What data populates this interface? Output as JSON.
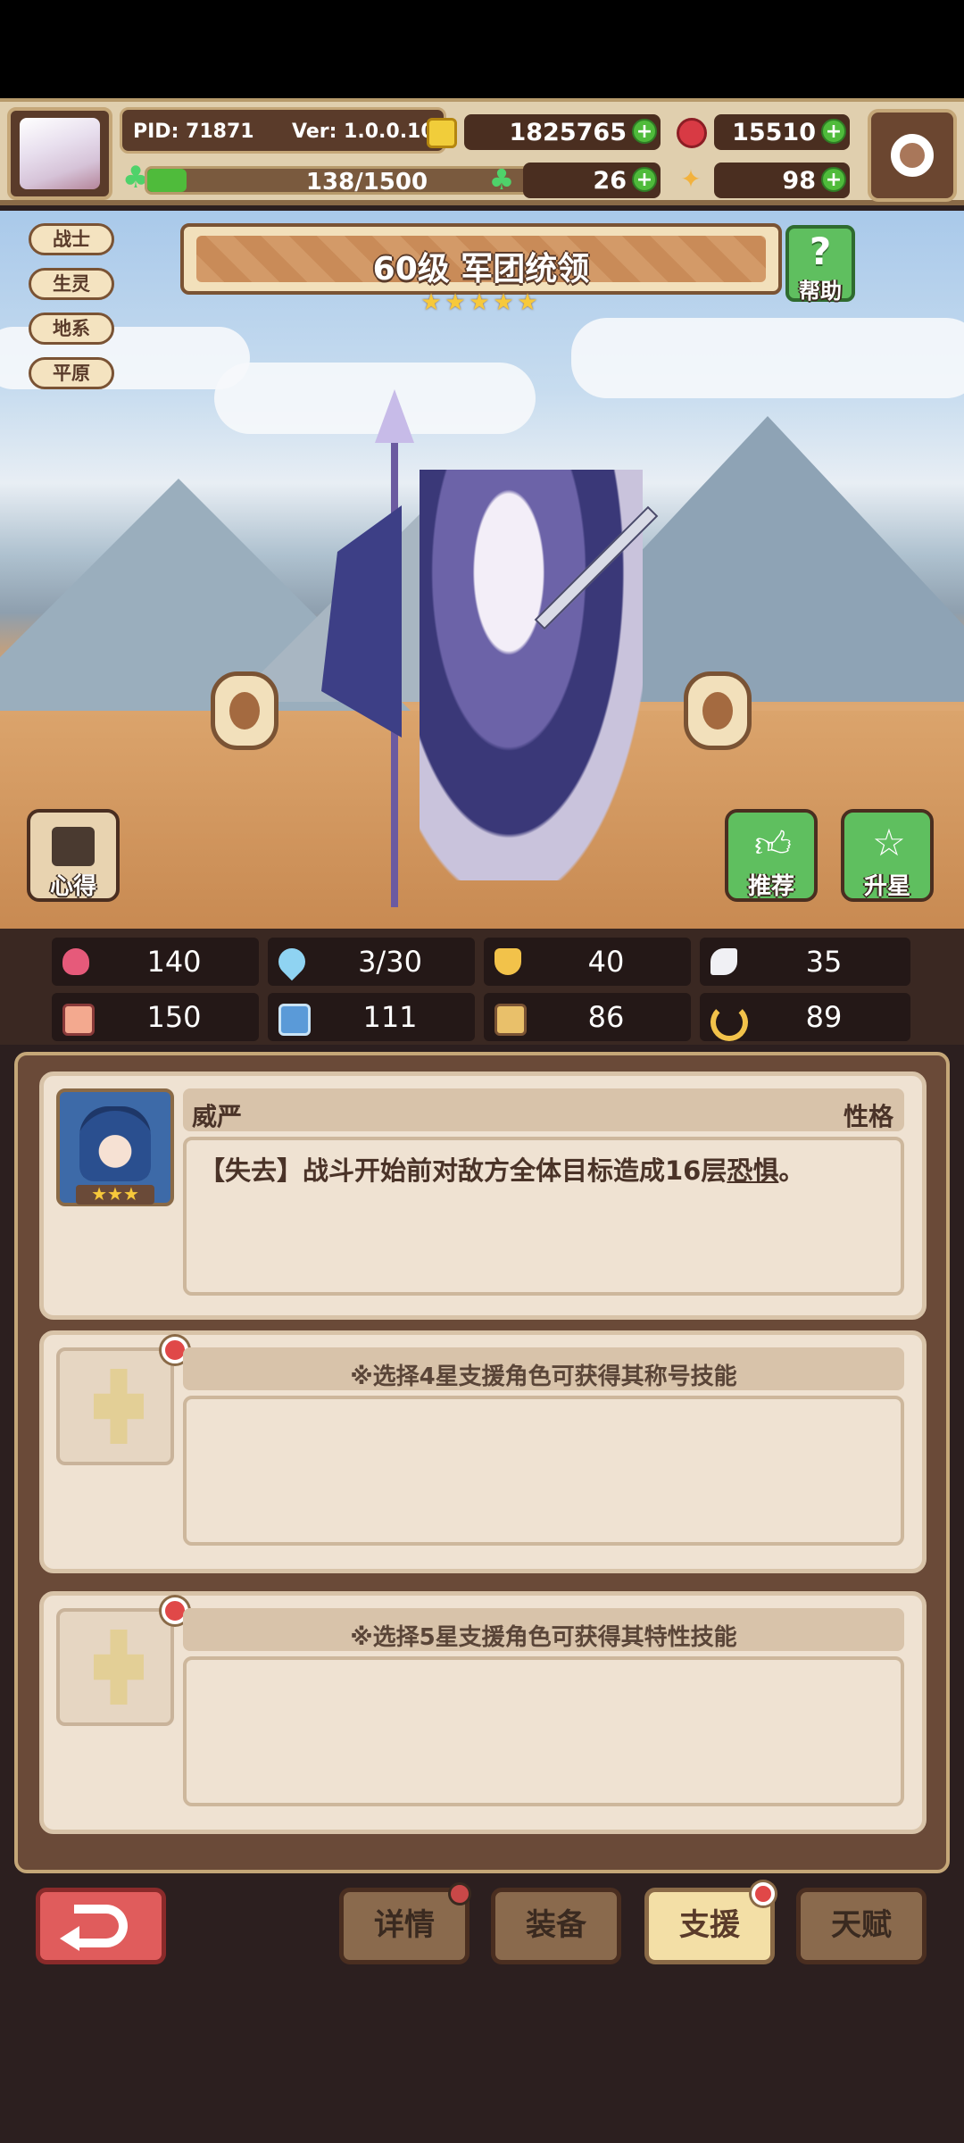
{
  "header": {
    "pid": "PID: 71871",
    "version": "Ver: 1.0.0.10",
    "exp": "138/1500",
    "gold": "1825765",
    "gems": "15510",
    "clover": "26",
    "bone": "98",
    "exp_progress": 0.092
  },
  "tags": [
    "战士",
    "生灵",
    "地系",
    "平原"
  ],
  "title": "60级 军团统领",
  "stars": 5,
  "help_label": "帮助",
  "side_buttons": {
    "insight": "心得",
    "recommend": "推荐",
    "star_up": "升星"
  },
  "stats": [
    {
      "icon": "heart-icon",
      "value": "140"
    },
    {
      "icon": "water-drop-icon",
      "value": "3/30"
    },
    {
      "icon": "shield-icon",
      "value": "40"
    },
    {
      "icon": "wing-icon",
      "value": "35"
    },
    {
      "icon": "fist-icon",
      "value": "150"
    },
    {
      "icon": "book-icon",
      "value": "111"
    },
    {
      "icon": "boot-icon",
      "value": "86"
    },
    {
      "icon": "horseshoe-icon",
      "value": "89"
    }
  ],
  "support": {
    "slot1": {
      "name": "威严",
      "category": "性格",
      "description_prefix": "【失去】战斗开始前对敌方全体目标造成16层",
      "description_link": "恐惧",
      "description_suffix": "。",
      "stars": 3
    },
    "slot2": {
      "hint": "※选择4星支援角色可获得其称号技能"
    },
    "slot3": {
      "hint": "※选择5星支援角色可获得其特性技能"
    }
  },
  "tabs": [
    "详情",
    "装备",
    "支援",
    "天赋"
  ],
  "colors": {
    "accent": "#c5a778",
    "panel": "#6a4a38",
    "red_dot": "#e04848",
    "green": "#4fbb3b"
  }
}
